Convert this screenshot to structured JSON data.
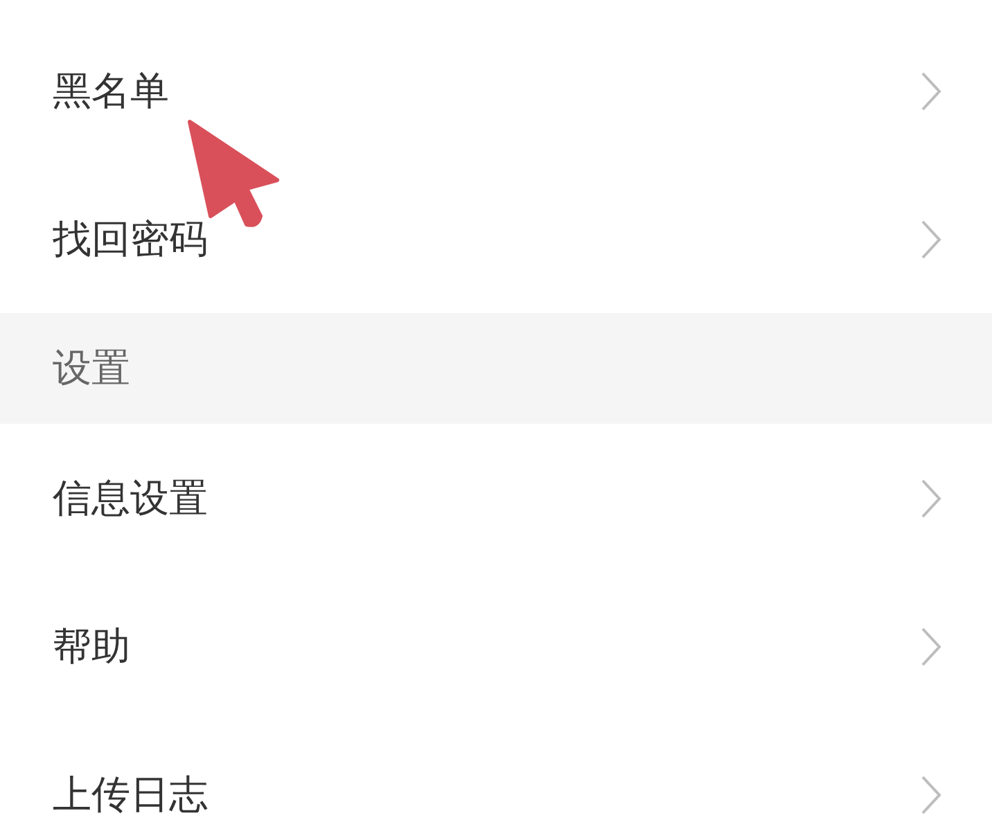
{
  "settings_list": [
    {
      "kind": "row",
      "label": "黑名单"
    },
    {
      "kind": "row",
      "label": "找回密码"
    },
    {
      "kind": "header",
      "label": "设置"
    },
    {
      "kind": "row",
      "label": "信息设置"
    },
    {
      "kind": "row",
      "label": "帮助"
    },
    {
      "kind": "row",
      "label": "上传日志"
    }
  ]
}
